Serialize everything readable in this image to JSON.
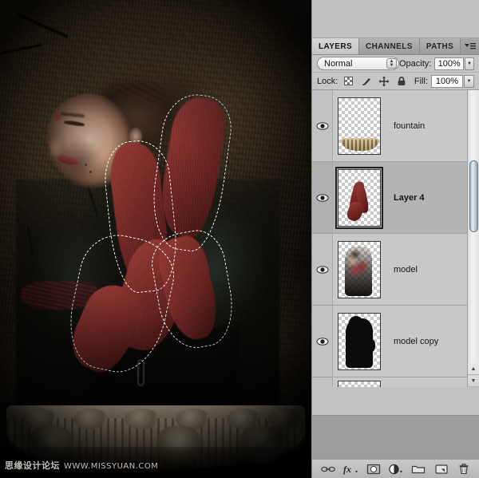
{
  "app": {
    "title": "Adobe Photoshop - Layers panel"
  },
  "canvas": {
    "description": "Photo composite of a woman with closed eyes against a dark grungy wall, red gloved arms with active marching-ants selection, stone fountain basin at bottom",
    "watermark_cn": "思缘设计论坛",
    "watermark_url": "WWW.MISSYUAN.COM"
  },
  "panel": {
    "tabs": [
      {
        "label": "LAYERS",
        "active": true
      },
      {
        "label": "CHANNELS",
        "active": false
      },
      {
        "label": "PATHS",
        "active": false
      }
    ],
    "menu_icon": "panel-menu-icon",
    "blend_mode": {
      "value": "Normal",
      "stepper_up": "▲",
      "stepper_down": "▼"
    },
    "opacity": {
      "label": "Opacity:",
      "value": "100%",
      "arrow": "▼"
    },
    "fill": {
      "label": "Fill:",
      "value": "100%",
      "arrow": "▼"
    },
    "lock": {
      "label": "Lock:",
      "items": [
        {
          "name": "lock-transparent-pixels-icon",
          "glyph": ""
        },
        {
          "name": "lock-image-pixels-icon",
          "glyph": "✎"
        },
        {
          "name": "lock-position-icon",
          "glyph": "✛"
        },
        {
          "name": "lock-all-icon",
          "glyph": "🔒"
        }
      ]
    },
    "layers": [
      {
        "name": "fountain",
        "visible": true,
        "selected": false,
        "eye_icon": "eye-icon",
        "thumb": "fountain"
      },
      {
        "name": "Layer 4",
        "visible": true,
        "selected": true,
        "eye_icon": "eye-icon",
        "thumb": "arms"
      },
      {
        "name": "model",
        "visible": true,
        "selected": false,
        "eye_icon": "eye-icon",
        "thumb": "model"
      },
      {
        "name": "model copy",
        "visible": true,
        "selected": false,
        "eye_icon": "eye-icon",
        "thumb": "silhouette"
      },
      {
        "name": "",
        "visible": false,
        "selected": false,
        "eye_icon": "",
        "thumb": "empty"
      }
    ],
    "scrollbar": {
      "up_arrow": "▲",
      "down_arrow": "▼"
    },
    "bottom_toolbar": [
      {
        "name": "link-layers-icon",
        "glyph": "🔗"
      },
      {
        "name": "layer-styles-fx-icon",
        "glyph": "fx"
      },
      {
        "name": "add-layer-mask-icon",
        "glyph": "◙"
      },
      {
        "name": "new-adjustment-layer-icon",
        "glyph": "◐"
      },
      {
        "name": "new-group-icon",
        "glyph": "▭"
      },
      {
        "name": "new-layer-icon",
        "glyph": "▣"
      },
      {
        "name": "delete-layer-icon",
        "glyph": "🗑"
      }
    ]
  },
  "colors": {
    "panel_bg": "#c2c2c2",
    "row_selected": "#b4b4b4",
    "accent_red": "#8e2f2a",
    "selection_outline": "#ffffff"
  }
}
